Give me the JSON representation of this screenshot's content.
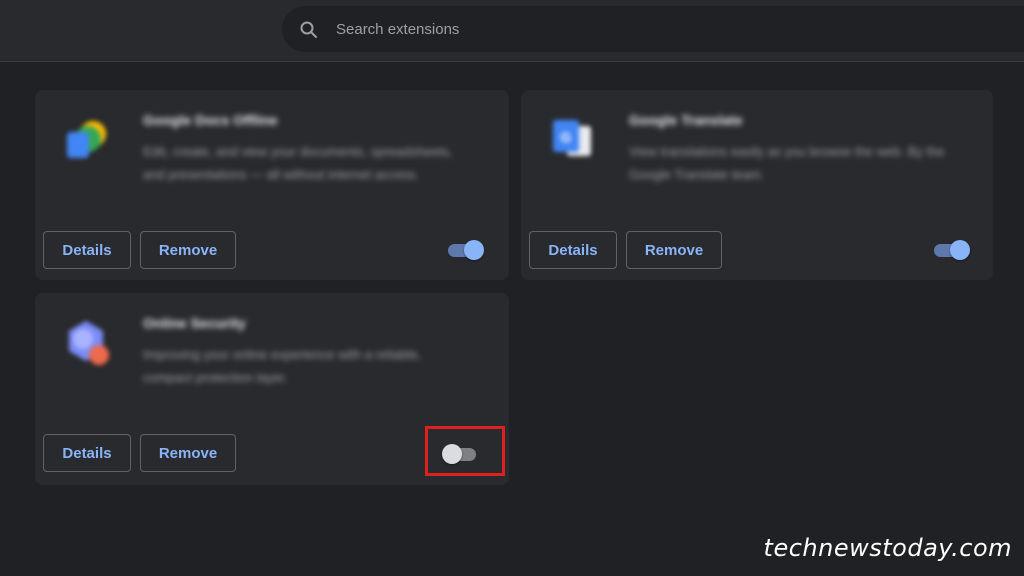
{
  "search": {
    "placeholder": "Search extensions",
    "value": ""
  },
  "extensions": [
    {
      "name": "Google Docs Offline",
      "description": "Edit, create, and view your documents, spreadsheets, and presentations — all without internet access.",
      "details_label": "Details",
      "remove_label": "Remove",
      "enabled": true,
      "icon": "google-docs-offline-icon"
    },
    {
      "name": "Google Translate",
      "description": "View translations easily as you browse the web. By the Google Translate team.",
      "details_label": "Details",
      "remove_label": "Remove",
      "enabled": true,
      "icon": "google-translate-icon"
    },
    {
      "name": "Online Security",
      "description": "Improving your online experience with a reliable, compact protection layer.",
      "details_label": "Details",
      "remove_label": "Remove",
      "enabled": false,
      "icon": "online-security-icon"
    }
  ],
  "watermark": "technewstoday.com",
  "colors": {
    "background": "#202124",
    "card": "#292a2d",
    "accent": "#8ab4f8",
    "highlight": "#e02020"
  }
}
